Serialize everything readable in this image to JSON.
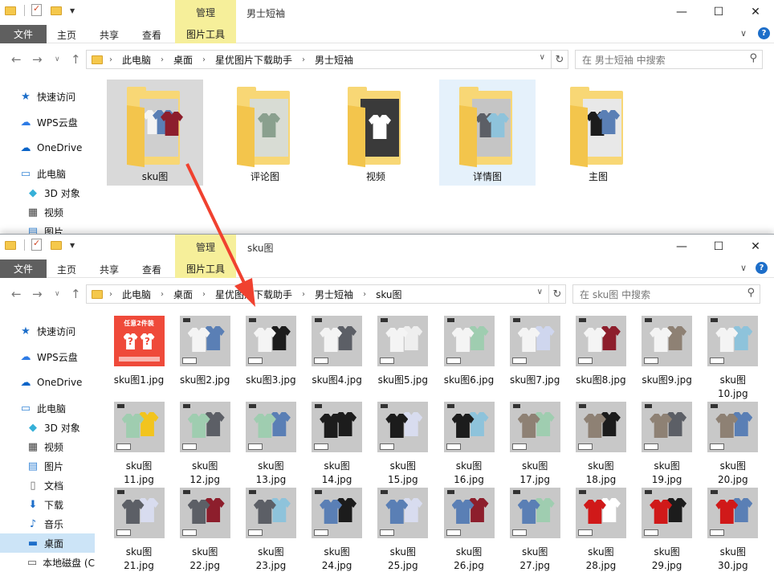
{
  "win1": {
    "ctx_tab": "管理",
    "title": "男士短袖",
    "menu": {
      "file": "文件",
      "home": "主页",
      "share": "共享",
      "view": "查看",
      "picture_tools": "图片工具"
    },
    "breadcrumb": [
      "此电脑",
      "桌面",
      "星优图片下载助手",
      "男士短袖"
    ],
    "search_placeholder": "在 男士短袖 中搜索",
    "nav": [
      "快速访问",
      "WPS云盘",
      "OneDrive",
      "此电脑",
      "3D 对象",
      "视频",
      "图片"
    ],
    "folders": [
      "sku图",
      "评论图",
      "视频",
      "详情图",
      "主图"
    ]
  },
  "win2": {
    "ctx_tab": "管理",
    "title": "sku图",
    "menu": {
      "file": "文件",
      "home": "主页",
      "share": "共享",
      "view": "查看",
      "picture_tools": "图片工具"
    },
    "breadcrumb": [
      "此电脑",
      "桌面",
      "星优图片下载助手",
      "男士短袖",
      "sku图"
    ],
    "search_placeholder": "在 sku图 中搜索",
    "nav": [
      "快速访问",
      "WPS云盘",
      "OneDrive",
      "此电脑",
      "3D 对象",
      "视频",
      "图片",
      "文档",
      "下载",
      "音乐",
      "桌面",
      "本地磁盘 (C"
    ],
    "promo_text": "任意2件装",
    "files": [
      "sku图1.jpg",
      "sku图2.jpg",
      "sku图3.jpg",
      "sku图4.jpg",
      "sku图5.jpg",
      "sku图6.jpg",
      "sku图7.jpg",
      "sku图8.jpg",
      "sku图9.jpg",
      "sku图10.jpg",
      "sku图11.jpg",
      "sku图12.jpg",
      "sku图13.jpg",
      "sku图14.jpg",
      "sku图15.jpg",
      "sku图16.jpg",
      "sku图17.jpg",
      "sku图18.jpg",
      "sku图19.jpg",
      "sku图20.jpg",
      "sku图21.jpg",
      "sku图22.jpg",
      "sku图23.jpg",
      "sku图24.jpg",
      "sku图25.jpg",
      "sku图26.jpg",
      "sku图27.jpg",
      "sku图28.jpg",
      "sku图29.jpg",
      "sku图30.jpg"
    ]
  },
  "colors": {
    "shirt_pairs": [
      [
        "#ef4a3a",
        "#ffffff"
      ],
      [
        "#f4f4f4",
        "#5a7fb5"
      ],
      [
        "#f4f4f4",
        "#1c1c1c"
      ],
      [
        "#f4f4f4",
        "#5c5f66"
      ],
      [
        "#f4f4f4",
        "#eeeeee"
      ],
      [
        "#f4f4f4",
        "#9fcdb0"
      ],
      [
        "#f4f4f4",
        "#cfd6ee"
      ],
      [
        "#f4f4f4",
        "#8d1e2c"
      ],
      [
        "#f4f4f4",
        "#8e8174"
      ],
      [
        "#f4f4f4",
        "#8ec3db"
      ],
      [
        "#9fcdb0",
        "#f2c41e"
      ],
      [
        "#9fcdb0",
        "#5c5f66"
      ],
      [
        "#9fcdb0",
        "#5a7fb5"
      ],
      [
        "#1c1c1c",
        "#1c1c1c"
      ],
      [
        "#1c1c1c",
        "#d8dcef"
      ],
      [
        "#1c1c1c",
        "#8ec3db"
      ],
      [
        "#8e8174",
        "#9fcdb0"
      ],
      [
        "#8e8174",
        "#1c1c1c"
      ],
      [
        "#8e8174",
        "#5c5f66"
      ],
      [
        "#8e8174",
        "#5a7fb5"
      ],
      [
        "#5c5f66",
        "#d8dcef"
      ],
      [
        "#5c5f66",
        "#8d1e2c"
      ],
      [
        "#5c5f66",
        "#8ec3db"
      ],
      [
        "#5a7fb5",
        "#1c1c1c"
      ],
      [
        "#5a7fb5",
        "#d8dcef"
      ],
      [
        "#5a7fb5",
        "#8d1e2c"
      ],
      [
        "#5a7fb5",
        "#9fcdb0"
      ],
      [
        "#d01919",
        "#ffffff"
      ],
      [
        "#d01919",
        "#1c1c1c"
      ],
      [
        "#d01919",
        "#5a7fb5"
      ]
    ]
  }
}
